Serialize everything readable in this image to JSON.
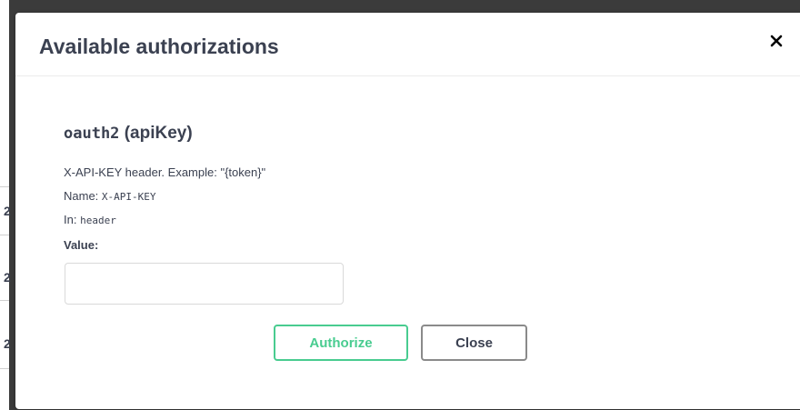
{
  "modal": {
    "title": "Available authorizations",
    "close_icon": "close-icon"
  },
  "scheme": {
    "name": "oauth2",
    "type": "(apiKey)",
    "description": "X-API-KEY header. Example: \"{token}\"",
    "name_label": "Name: ",
    "name_value": "X-API-KEY",
    "in_label": "In: ",
    "in_value": "header",
    "value_label": "Value:",
    "value_input": ""
  },
  "buttons": {
    "authorize_label": "Authorize",
    "close_label": "Close"
  },
  "backdrop": {
    "row_digits": [
      "2",
      "2",
      "2"
    ]
  },
  "colors": {
    "accent": "#49cc90",
    "text": "#3b4151"
  }
}
